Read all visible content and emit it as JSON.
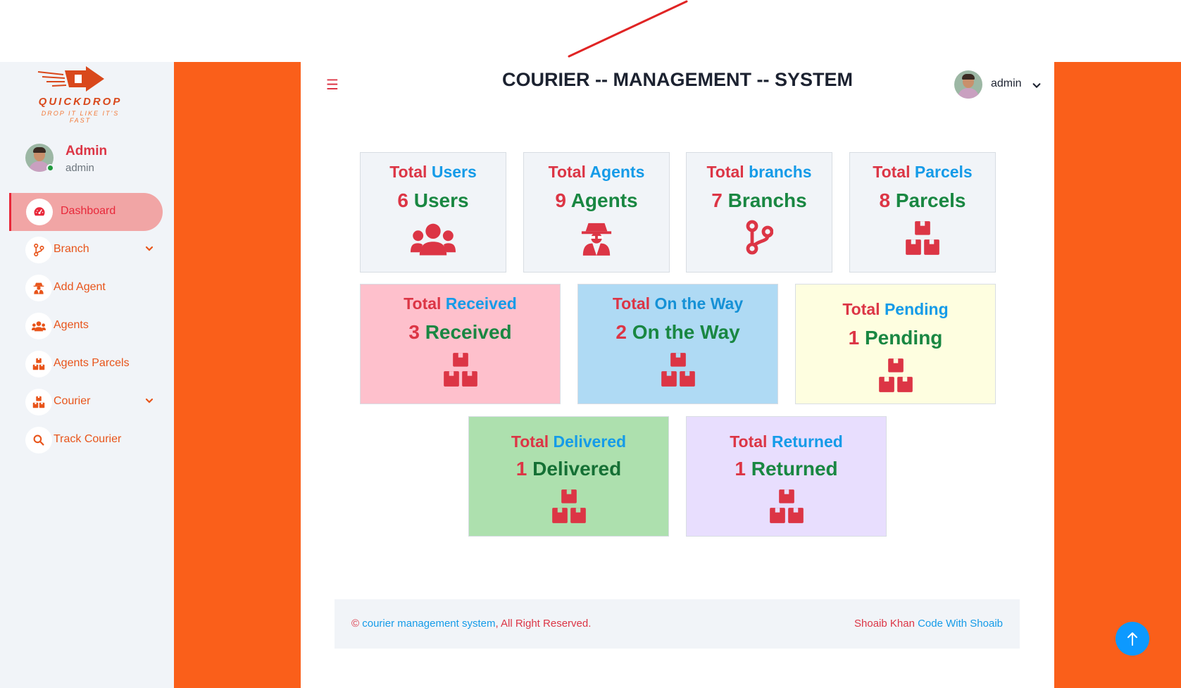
{
  "app": {
    "brand": "QUICKDROP",
    "tagline": "DROP IT LIKE IT'S FAST",
    "title": "COURIER -- MANAGEMENT -- SYSTEM",
    "menu_icon": "hamburger-icon",
    "colors": {
      "accent": "#fa5f1a",
      "red": "#dc3545",
      "blue": "#159be8",
      "green": "#198742"
    }
  },
  "sidebar": {
    "profile": {
      "name": "Admin",
      "role": "admin"
    },
    "items": [
      {
        "label": "Dashboard",
        "icon": "speedometer-icon",
        "active": true
      },
      {
        "label": "Branch",
        "icon": "branch-icon",
        "has_submenu": true
      },
      {
        "label": "Add Agent",
        "icon": "spy-icon"
      },
      {
        "label": "Agents",
        "icon": "users-icon"
      },
      {
        "label": "Agents Parcels",
        "icon": "boxes-icon"
      },
      {
        "label": "Courier",
        "icon": "boxes-icon",
        "has_submenu": true
      },
      {
        "label": "Track Courier",
        "icon": "search-icon"
      }
    ]
  },
  "header": {
    "user": "admin"
  },
  "cards": [
    {
      "total": "Total",
      "label": "Users",
      "count": "6",
      "count_label": "Users",
      "icon": "users-icon",
      "bg": "#f1f4f8"
    },
    {
      "total": "Total",
      "label": "Agents",
      "count": "9",
      "count_label": "Agents",
      "icon": "spy-icon",
      "bg": "#f1f4f8"
    },
    {
      "total": "Total",
      "label": "branchs",
      "count": "7",
      "count_label": "Branchs",
      "icon": "branch-icon",
      "bg": "#f1f4f8"
    },
    {
      "total": "Total",
      "label": "Parcels",
      "count": "8",
      "count_label": "Parcels",
      "icon": "boxes-icon",
      "bg": "#f1f4f8"
    },
    {
      "total": "Total",
      "label": "Received",
      "count": "3",
      "count_label": "Received",
      "icon": "boxes-icon",
      "bg": "#fec0cc"
    },
    {
      "total": "Total",
      "label": "On the Way",
      "count": "2",
      "count_label": "On the Way",
      "icon": "boxes-icon",
      "bg": "#afdaf4"
    },
    {
      "total": "Total",
      "label": "Pending",
      "count": "1",
      "count_label": "Pending",
      "icon": "boxes-icon",
      "bg": "#fefee0"
    },
    {
      "total": "Total",
      "label": "Delivered",
      "count": "1",
      "count_label": "Delivered",
      "icon": "boxes-icon",
      "bg": "#ade0ae"
    },
    {
      "total": "Total",
      "label": "Returned",
      "count": "1",
      "count_label": "Returned",
      "icon": "boxes-icon",
      "bg": "#e8defe"
    }
  ],
  "footer": {
    "copyright": "©",
    "link": "courier management system",
    "rights": ", All Right Reserved.",
    "author": "Shoaib Khan",
    "author_link": "Code With Shoaib"
  }
}
